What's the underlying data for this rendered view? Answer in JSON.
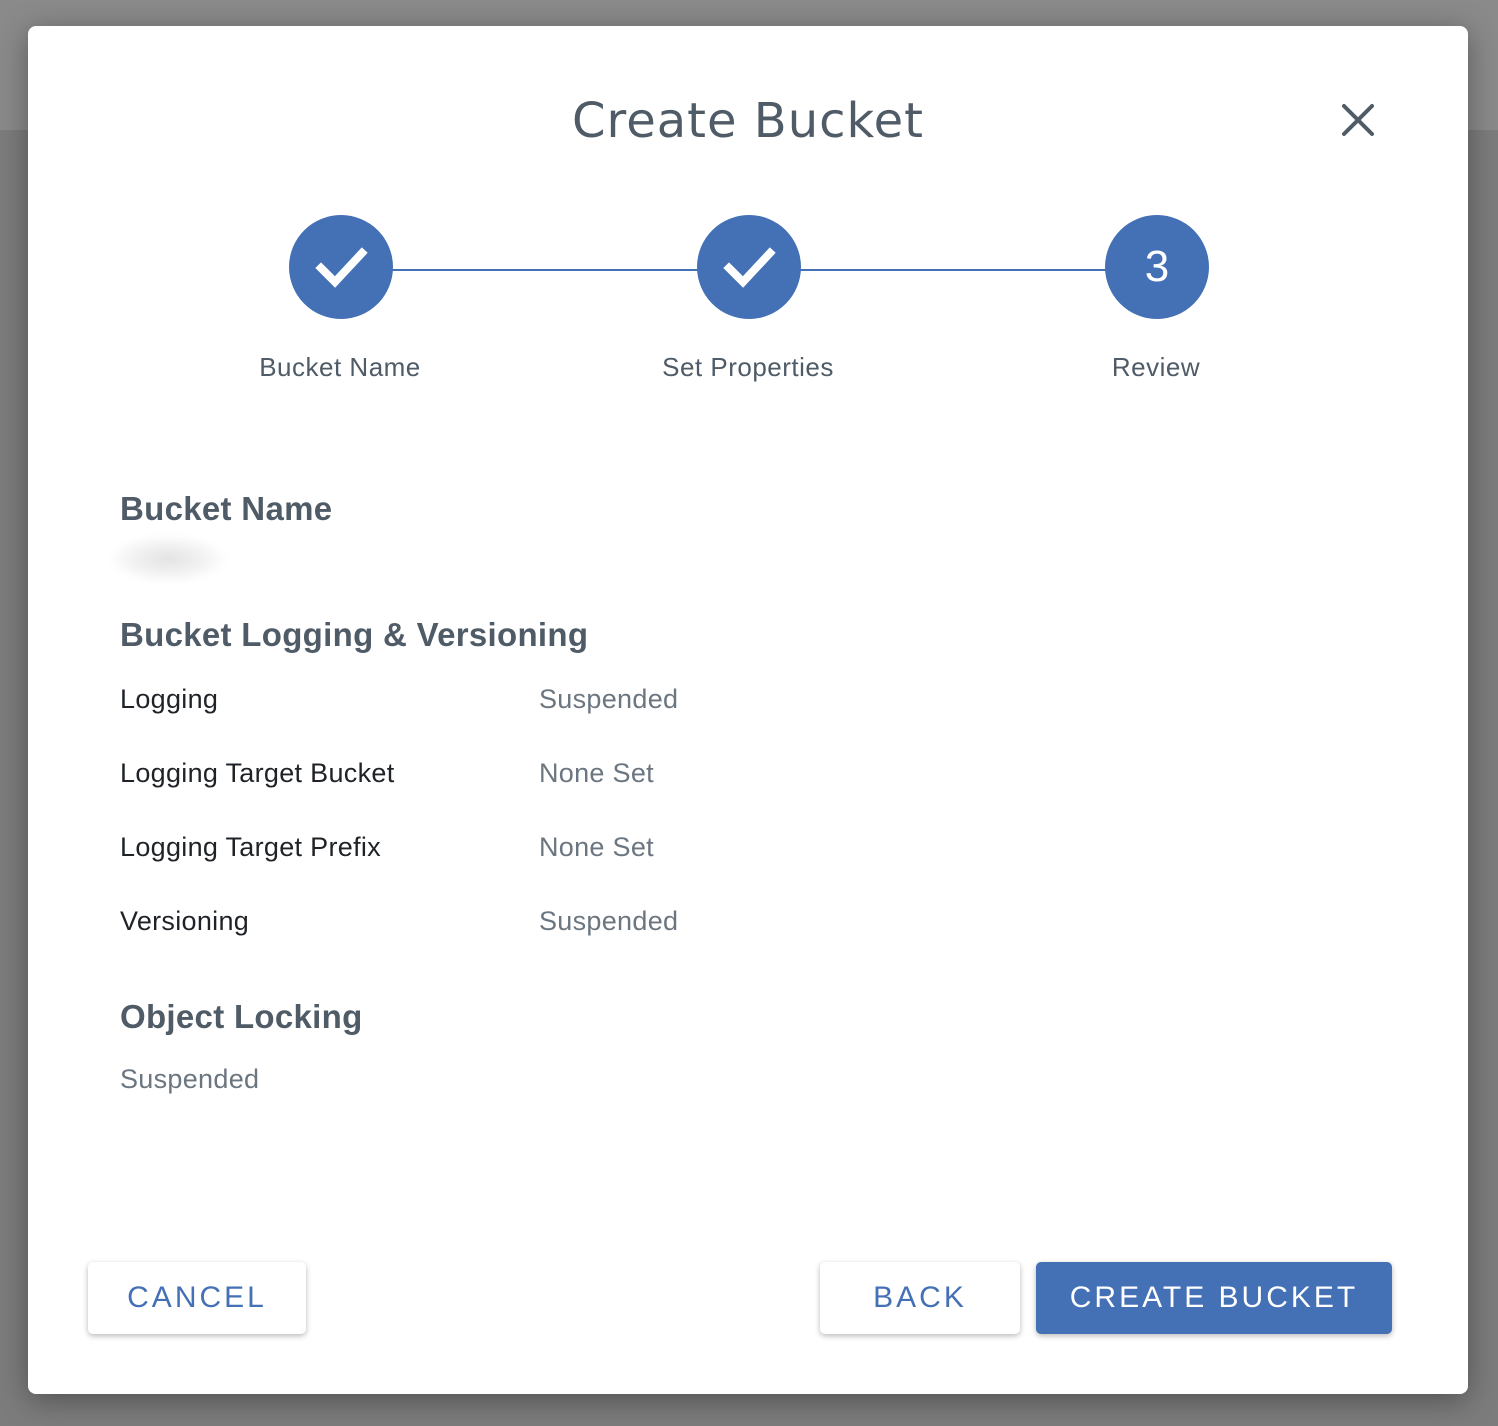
{
  "dialog": {
    "title": "Create Bucket",
    "close_icon": "close-icon"
  },
  "stepper": {
    "steps": [
      {
        "label": "Bucket Name",
        "state": "completed",
        "icon": "check-icon"
      },
      {
        "label": "Set Properties",
        "state": "completed",
        "icon": "check-icon"
      },
      {
        "label": "Review",
        "state": "active",
        "number": "3"
      }
    ],
    "accent_color": "#4470b6"
  },
  "review": {
    "bucket_name_heading": "Bucket Name",
    "logging_heading": "Bucket Logging & Versioning",
    "properties": [
      {
        "label": "Logging",
        "value": "Suspended"
      },
      {
        "label": "Logging Target Bucket",
        "value": "None Set"
      },
      {
        "label": "Logging Target Prefix",
        "value": "None Set"
      },
      {
        "label": "Versioning",
        "value": "Suspended"
      }
    ],
    "object_locking_heading": "Object Locking",
    "object_locking_value": "Suspended"
  },
  "footer": {
    "cancel_label": "CANCEL",
    "back_label": "BACK",
    "create_label": "CREATE BUCKET"
  }
}
